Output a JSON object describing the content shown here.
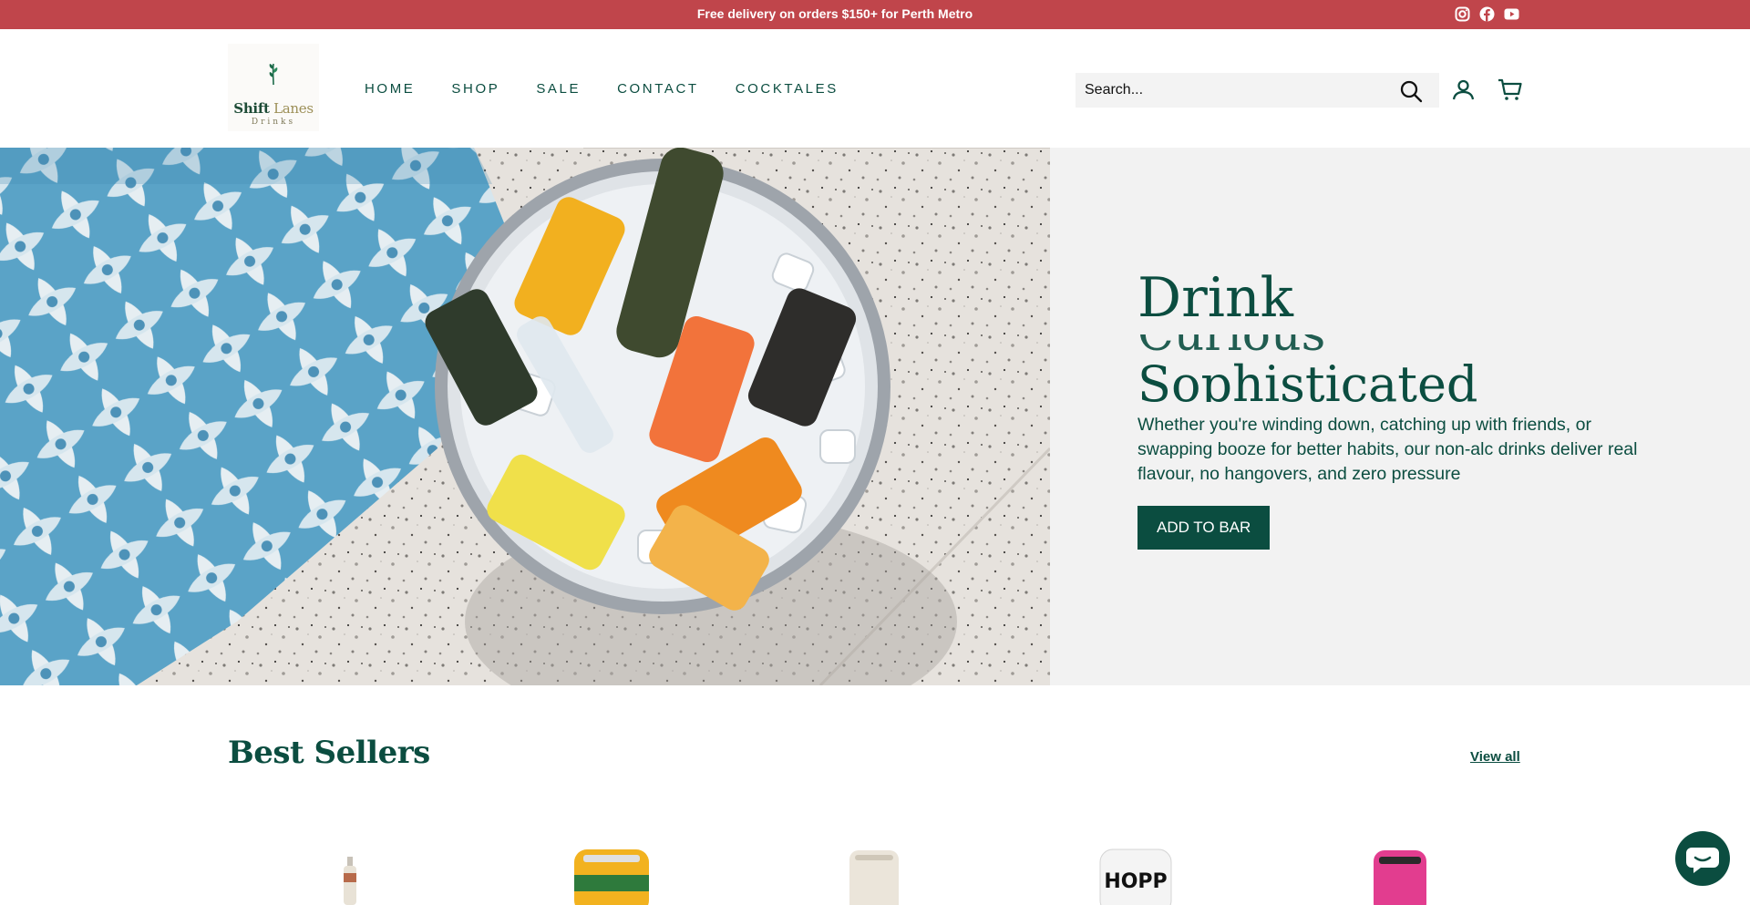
{
  "announcement": {
    "text": "Free delivery on orders $150+ for Perth Metro",
    "socials": [
      "instagram-icon",
      "facebook-icon",
      "youtube-icon"
    ]
  },
  "brand": {
    "name_a": "Shift",
    "name_b": " Lanes",
    "sub": "Drinks"
  },
  "nav": {
    "items": [
      "HOME",
      "SHOP",
      "SALE",
      "CONTACT",
      "COCKTALES"
    ]
  },
  "search": {
    "placeholder": "Search..."
  },
  "hero": {
    "title_line_1": "Drink",
    "title_line_2": "Curious",
    "title_line_3": "Sophisticated",
    "subtitle": "Whether you're winding down, catching up with friends, or swapping booze for better habits, our non-alc drinks deliver real flavour, no hangovers, and zero pressure",
    "cta": "ADD TO BAR"
  },
  "best_sellers": {
    "title": "Best Sellers",
    "view_all": "View all"
  },
  "colors": {
    "accent": "#0b4d40",
    "announcement": "#c0454b",
    "hero_bg": "#f2f2f2"
  }
}
